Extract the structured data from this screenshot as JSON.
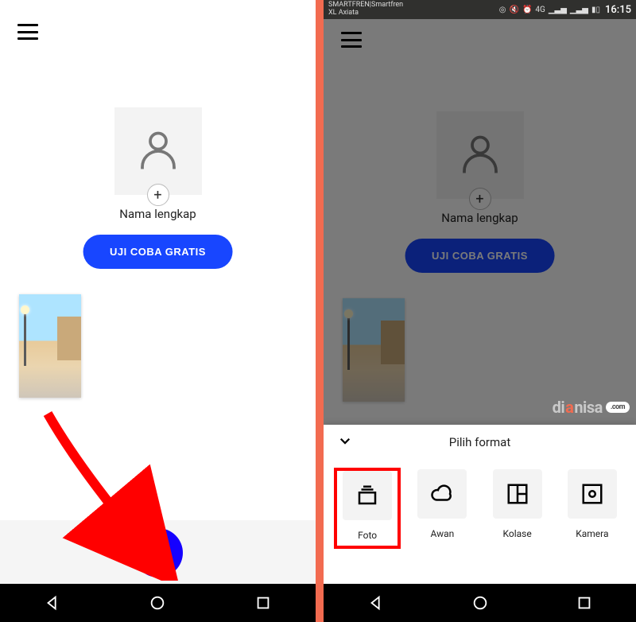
{
  "left": {
    "name_label": "Nama lengkap",
    "cta_label": "UJI COBA GRATIS"
  },
  "right": {
    "statusbar": {
      "carrier1": "SMARTFREN|Smartfren",
      "carrier2": "XL Axiata",
      "net_label": "4G",
      "time": "16:15"
    },
    "name_label": "Nama lengkap",
    "cta_label": "UJI COBA GRATIS",
    "watermark": {
      "part1": "di",
      "part2": "a",
      "part3": "nisa",
      "suffix": ".com"
    },
    "sheet": {
      "title": "Pilih format",
      "items": [
        {
          "key": "foto",
          "label": "Foto"
        },
        {
          "key": "awan",
          "label": "Awan"
        },
        {
          "key": "kolase",
          "label": "Kolase"
        },
        {
          "key": "kamera",
          "label": "Kamera"
        }
      ]
    }
  }
}
